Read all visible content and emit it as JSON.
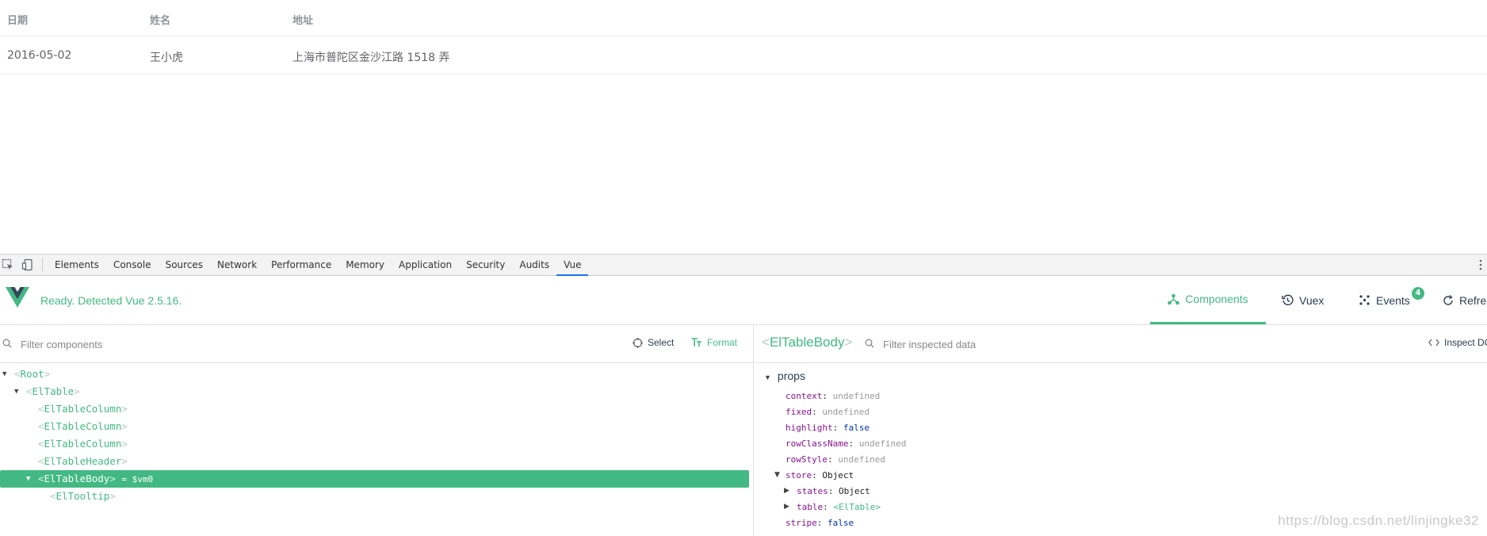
{
  "table": {
    "headers": [
      "日期",
      "姓名",
      "地址"
    ],
    "rows": [
      [
        "2016-05-02",
        "王小虎",
        "上海市普陀区金沙江路 1518 弄"
      ]
    ]
  },
  "devtools": {
    "tabs": [
      "Elements",
      "Console",
      "Sources",
      "Network",
      "Performance",
      "Memory",
      "Application",
      "Security",
      "Audits",
      "Vue"
    ],
    "active_tab": "Vue"
  },
  "vue": {
    "status": "Ready. Detected Vue 2.5.16.",
    "nav": {
      "components": "Components",
      "vuex": "Vuex",
      "events": "Events",
      "events_count": "4",
      "refresh": "Refre"
    },
    "left": {
      "filter_placeholder": "Filter components",
      "select_label": "Select",
      "format_label": "Format",
      "tree": [
        {
          "name": "Root"
        },
        {
          "name": "ElTable"
        },
        {
          "name": "ElTableColumn"
        },
        {
          "name": "ElTableColumn"
        },
        {
          "name": "ElTableColumn"
        },
        {
          "name": "ElTableHeader"
        },
        {
          "name": "ElTableBody",
          "vm": "= $vm0"
        },
        {
          "name": "ElTooltip"
        }
      ]
    },
    "right": {
      "selected_component": "ElTableBody",
      "filter_placeholder": "Filter inspected data",
      "inspect_dom_label": "Inspect DO",
      "section": "props",
      "props": [
        {
          "key": "context",
          "value": "undefined"
        },
        {
          "key": "fixed",
          "value": "undefined"
        },
        {
          "key": "highlight",
          "value": "false"
        },
        {
          "key": "rowClassName",
          "value": "undefined"
        },
        {
          "key": "rowStyle",
          "value": "undefined"
        },
        {
          "key": "store",
          "value": "Object"
        },
        {
          "key": "states",
          "value": "Object"
        },
        {
          "key": "table",
          "value": "<ElTable>"
        },
        {
          "key": "stripe",
          "value": "false"
        }
      ]
    },
    "watermark": "https://blog.csdn.net/linjingke32"
  },
  "colors": {
    "vue_green": "#42b983",
    "devtools_active": "#1a73e8"
  }
}
